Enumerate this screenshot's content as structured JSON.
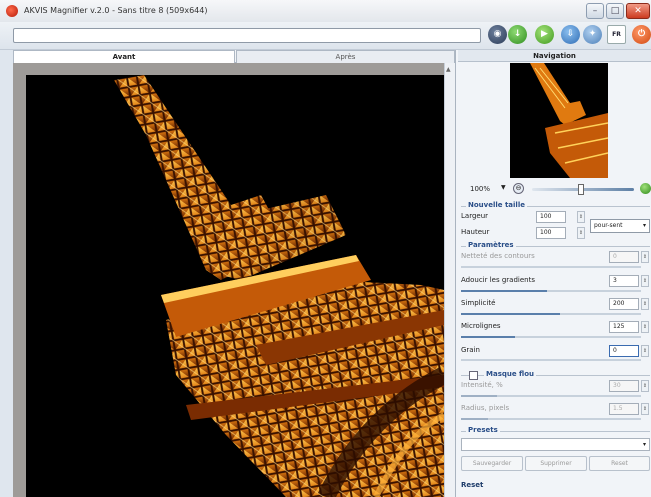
{
  "window": {
    "title": "AKVIS Magnifier v.2.0 - Sans titre 8 (509x644)",
    "controls": {
      "minimize": "–",
      "maximize": "□",
      "close": "✕"
    }
  },
  "toolbar": {
    "path_value": "",
    "lang_label": "FR",
    "icons": [
      "open-icon",
      "save-icon",
      "process-icon",
      "download-icon",
      "fx-icon",
      "language-icon",
      "power-icon"
    ]
  },
  "tabs": [
    {
      "label": "Avant",
      "active": true
    },
    {
      "label": "Après",
      "active": false
    }
  ],
  "navigation": {
    "title": "Navigation",
    "zoom_value": "100%",
    "zoom_dropdown": "▼",
    "zoom_fit_symbol": "⊖",
    "zoom_level": 0.48
  },
  "new_size": {
    "title": "Nouvelle taille",
    "width_label": "Largeur",
    "width_value": "100",
    "height_label": "Hauteur",
    "height_value": "100",
    "units": "pour-sent"
  },
  "parameters": {
    "title": "Paramètres",
    "items": [
      {
        "label": "Netteté des contours",
        "value": "0",
        "disabled": true,
        "level": 0.0
      },
      {
        "label": "Adoucir les gradients",
        "value": "3",
        "disabled": false,
        "level": 0.48
      },
      {
        "label": "Simplicité",
        "value": "200",
        "disabled": false,
        "level": 0.55
      },
      {
        "label": "Microlignes",
        "value": "125",
        "disabled": false,
        "level": 0.3
      },
      {
        "label": "Grain",
        "value": "0",
        "disabled": false,
        "level": 0.0
      }
    ]
  },
  "unsharp_mask": {
    "title": "Masque flou",
    "checked": false,
    "items": [
      {
        "label": "Intensité, %",
        "value": "30",
        "disabled": true,
        "level": 0.2
      },
      {
        "label": "Radius, pixels",
        "value": "1.5",
        "disabled": true,
        "level": 0.15
      }
    ]
  },
  "presets": {
    "title": "Presets",
    "selected": "",
    "save_label": "Sauvegarder",
    "delete_label": "Supprimer",
    "reset_label": "Reset",
    "reset_link": "Reset"
  },
  "colors": {
    "accent": "#2a4e88",
    "tower_light": "#ffd25a",
    "tower_mid": "#e07a10",
    "tower_dark": "#5a1d02",
    "background_dark": "#000000"
  }
}
